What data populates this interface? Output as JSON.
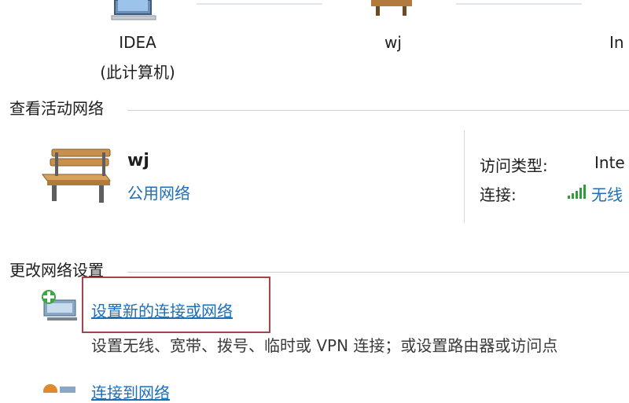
{
  "network_map": {
    "computer_label": "IDEA",
    "computer_sublabel": "(此计算机)",
    "network_label": "wj",
    "internet_label": "In"
  },
  "active_networks": {
    "title": "查看活动网络",
    "network_name": "wj",
    "network_type": "公用网络",
    "access_type_label": "访问类型:",
    "access_type_value": "Inte",
    "connection_label": "连接:",
    "connection_value": "无线"
  },
  "change_settings": {
    "title": "更改网络设置",
    "task1_link": "设置新的连接或网络",
    "task1_desc": "设置无线、宽带、拨号、临时或 VPN 连接；或设置路由器或访问点",
    "task2_link": "连接到网络"
  },
  "colors": {
    "link": "#1f6fb8",
    "highlight_border": "#a4434b",
    "signal_green": "#2f9e3a"
  }
}
